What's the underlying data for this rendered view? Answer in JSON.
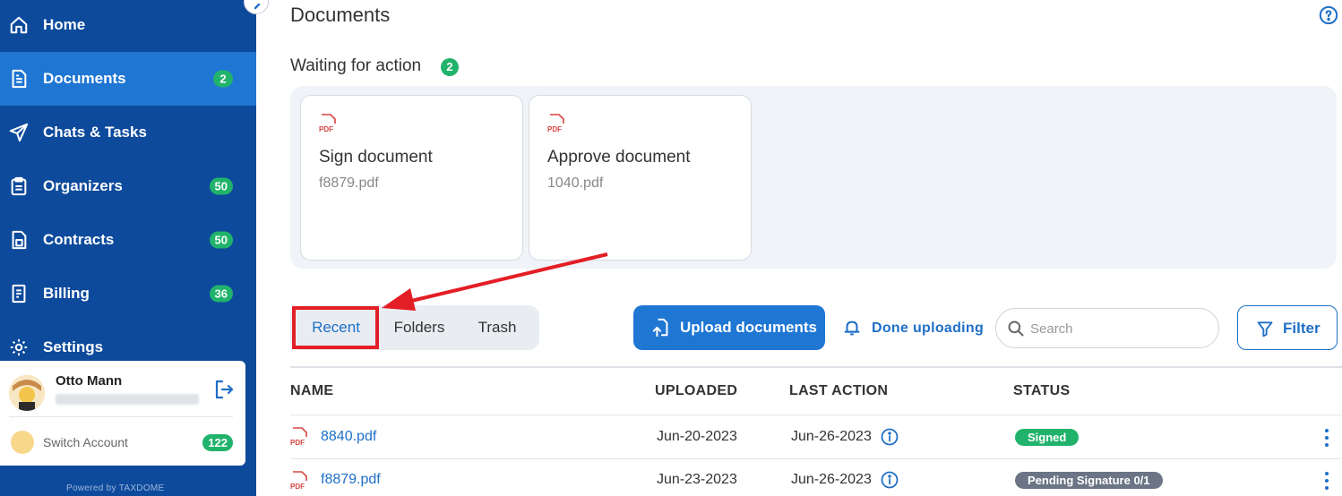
{
  "sidebar": {
    "items": [
      {
        "label": "Home",
        "icon": "home-icon",
        "count": null
      },
      {
        "label": "Documents",
        "icon": "document-icon",
        "count": "2"
      },
      {
        "label": "Chats & Tasks",
        "icon": "paper-plane-icon",
        "count": null
      },
      {
        "label": "Organizers",
        "icon": "clipboard-icon",
        "count": "50"
      },
      {
        "label": "Contracts",
        "icon": "contract-icon",
        "count": "50"
      },
      {
        "label": "Billing",
        "icon": "receipt-icon",
        "count": "36"
      },
      {
        "label": "Settings",
        "icon": "gear-icon",
        "count": null
      }
    ],
    "account": {
      "name": "Otto Mann",
      "switch_label": "Switch Account",
      "switch_count": "122"
    },
    "powered_by": "Powered by TAXDOME"
  },
  "main": {
    "title": "Documents",
    "waiting": {
      "title": "Waiting for action",
      "count": "2",
      "cards": [
        {
          "title": "Sign document",
          "file": "f8879.pdf"
        },
        {
          "title": "Approve document",
          "file": "1040.pdf"
        }
      ]
    },
    "tabs": [
      {
        "label": "Recent"
      },
      {
        "label": "Folders"
      },
      {
        "label": "Trash"
      }
    ],
    "toolbar": {
      "upload_label": "Upload documents",
      "done_label": "Done uploading",
      "search_placeholder": "Search",
      "filter_label": "Filter"
    },
    "table": {
      "headers": {
        "name": "NAME",
        "uploaded": "UPLOADED",
        "last_action": "LAST ACTION",
        "status": "STATUS"
      },
      "rows": [
        {
          "name": "8840.pdf",
          "uploaded": "Jun-20-2023",
          "last_action": "Jun-26-2023",
          "status": "Signed"
        },
        {
          "name": "f8879.pdf",
          "uploaded": "Jun-23-2023",
          "last_action": "Jun-26-2023",
          "status": "Pending Signature 0/1"
        }
      ]
    }
  },
  "colors": {
    "sidebar_bg": "#0d4a9c",
    "active_nav": "#1f76d3",
    "accent": "#1f6fc7",
    "count_badge": "#21b36b",
    "annotation_red": "#e41e25",
    "pending_badge": "#6b7585"
  }
}
